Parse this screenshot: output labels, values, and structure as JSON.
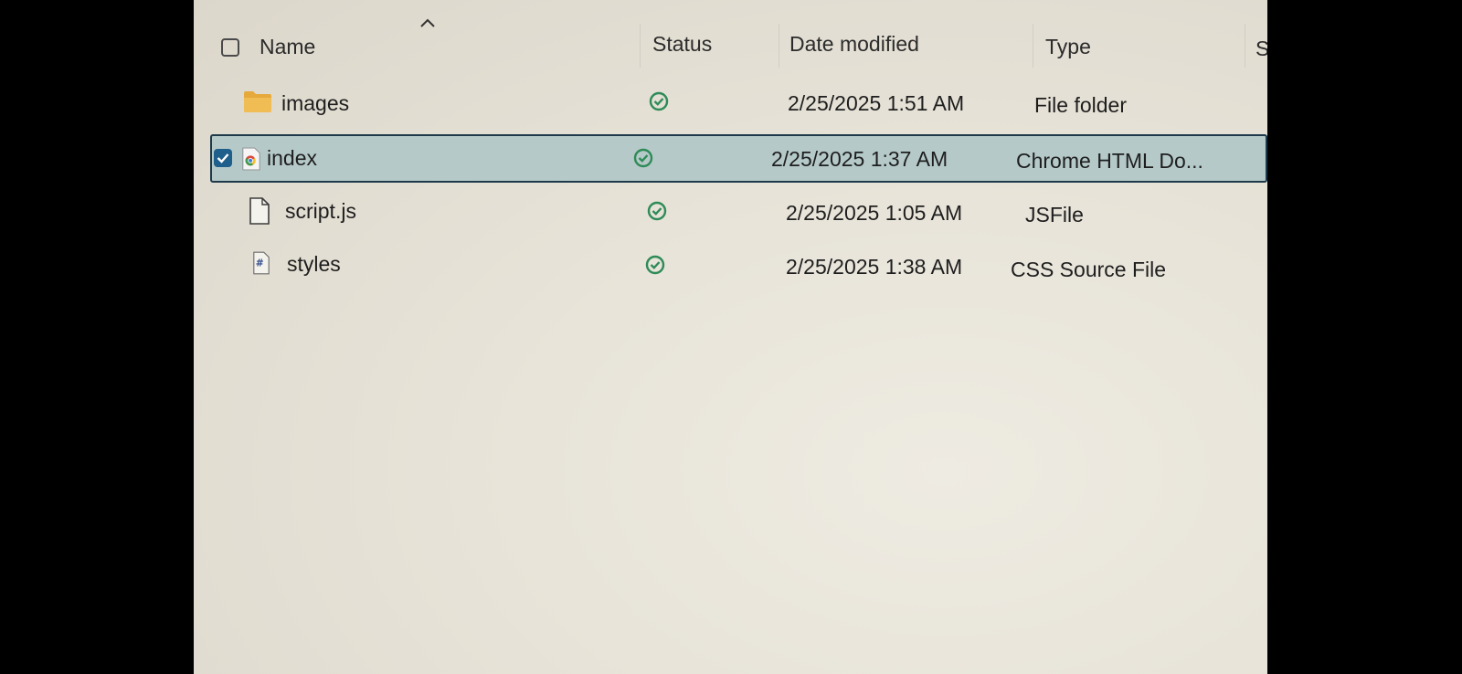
{
  "columns": {
    "name": "Name",
    "status": "Status",
    "date_modified": "Date modified",
    "type": "Type",
    "size_partial": "Si"
  },
  "colors": {
    "selected_row": "#b6c9c9",
    "selected_border": "#1e3a4a",
    "status_ok": "#2e8b57",
    "folder": "#e6a93b",
    "checkbox_checked": "#1f5f8c"
  },
  "files": [
    {
      "name": "images",
      "icon": "folder-icon",
      "status": "synced-icon",
      "date": "2/25/2025 1:51 AM",
      "type": "File folder",
      "selected": false
    },
    {
      "name": "index",
      "icon": "chrome-html-icon",
      "status": "synced-icon",
      "date": "2/25/2025 1:37 AM",
      "type": "Chrome HTML Do...",
      "selected": true
    },
    {
      "name": "script.js",
      "icon": "blank-file-icon",
      "status": "synced-icon",
      "date": "2/25/2025 1:05 AM",
      "type": "JSFile",
      "selected": false
    },
    {
      "name": "styles",
      "icon": "css-file-icon",
      "status": "synced-icon",
      "date": "2/25/2025 1:38 AM",
      "type": "CSS Source File",
      "selected": false
    }
  ]
}
